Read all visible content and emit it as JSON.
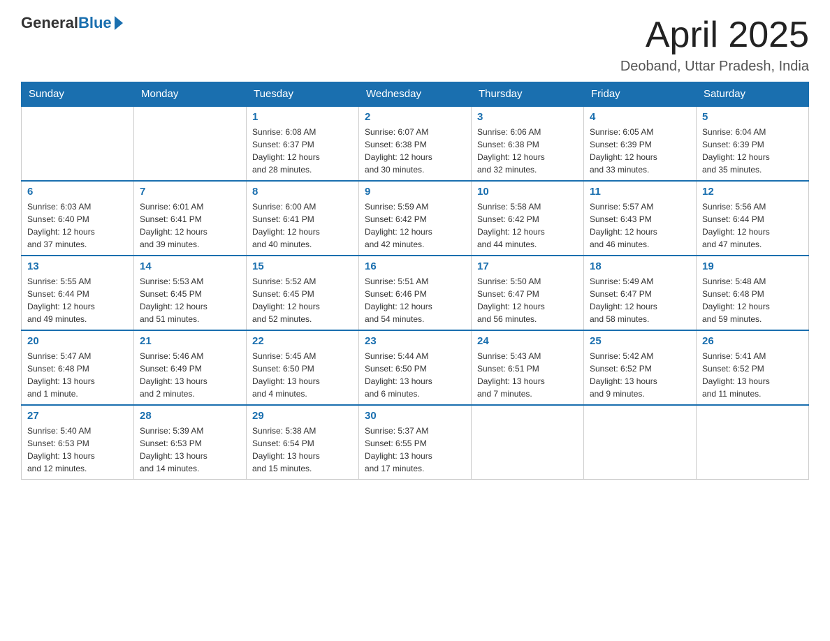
{
  "header": {
    "logo_general": "General",
    "logo_blue": "Blue",
    "month_title": "April 2025",
    "location": "Deoband, Uttar Pradesh, India"
  },
  "weekdays": [
    "Sunday",
    "Monday",
    "Tuesday",
    "Wednesday",
    "Thursday",
    "Friday",
    "Saturday"
  ],
  "weeks": [
    [
      {
        "day": "",
        "info": ""
      },
      {
        "day": "",
        "info": ""
      },
      {
        "day": "1",
        "info": "Sunrise: 6:08 AM\nSunset: 6:37 PM\nDaylight: 12 hours\nand 28 minutes."
      },
      {
        "day": "2",
        "info": "Sunrise: 6:07 AM\nSunset: 6:38 PM\nDaylight: 12 hours\nand 30 minutes."
      },
      {
        "day": "3",
        "info": "Sunrise: 6:06 AM\nSunset: 6:38 PM\nDaylight: 12 hours\nand 32 minutes."
      },
      {
        "day": "4",
        "info": "Sunrise: 6:05 AM\nSunset: 6:39 PM\nDaylight: 12 hours\nand 33 minutes."
      },
      {
        "day": "5",
        "info": "Sunrise: 6:04 AM\nSunset: 6:39 PM\nDaylight: 12 hours\nand 35 minutes."
      }
    ],
    [
      {
        "day": "6",
        "info": "Sunrise: 6:03 AM\nSunset: 6:40 PM\nDaylight: 12 hours\nand 37 minutes."
      },
      {
        "day": "7",
        "info": "Sunrise: 6:01 AM\nSunset: 6:41 PM\nDaylight: 12 hours\nand 39 minutes."
      },
      {
        "day": "8",
        "info": "Sunrise: 6:00 AM\nSunset: 6:41 PM\nDaylight: 12 hours\nand 40 minutes."
      },
      {
        "day": "9",
        "info": "Sunrise: 5:59 AM\nSunset: 6:42 PM\nDaylight: 12 hours\nand 42 minutes."
      },
      {
        "day": "10",
        "info": "Sunrise: 5:58 AM\nSunset: 6:42 PM\nDaylight: 12 hours\nand 44 minutes."
      },
      {
        "day": "11",
        "info": "Sunrise: 5:57 AM\nSunset: 6:43 PM\nDaylight: 12 hours\nand 46 minutes."
      },
      {
        "day": "12",
        "info": "Sunrise: 5:56 AM\nSunset: 6:44 PM\nDaylight: 12 hours\nand 47 minutes."
      }
    ],
    [
      {
        "day": "13",
        "info": "Sunrise: 5:55 AM\nSunset: 6:44 PM\nDaylight: 12 hours\nand 49 minutes."
      },
      {
        "day": "14",
        "info": "Sunrise: 5:53 AM\nSunset: 6:45 PM\nDaylight: 12 hours\nand 51 minutes."
      },
      {
        "day": "15",
        "info": "Sunrise: 5:52 AM\nSunset: 6:45 PM\nDaylight: 12 hours\nand 52 minutes."
      },
      {
        "day": "16",
        "info": "Sunrise: 5:51 AM\nSunset: 6:46 PM\nDaylight: 12 hours\nand 54 minutes."
      },
      {
        "day": "17",
        "info": "Sunrise: 5:50 AM\nSunset: 6:47 PM\nDaylight: 12 hours\nand 56 minutes."
      },
      {
        "day": "18",
        "info": "Sunrise: 5:49 AM\nSunset: 6:47 PM\nDaylight: 12 hours\nand 58 minutes."
      },
      {
        "day": "19",
        "info": "Sunrise: 5:48 AM\nSunset: 6:48 PM\nDaylight: 12 hours\nand 59 minutes."
      }
    ],
    [
      {
        "day": "20",
        "info": "Sunrise: 5:47 AM\nSunset: 6:48 PM\nDaylight: 13 hours\nand 1 minute."
      },
      {
        "day": "21",
        "info": "Sunrise: 5:46 AM\nSunset: 6:49 PM\nDaylight: 13 hours\nand 2 minutes."
      },
      {
        "day": "22",
        "info": "Sunrise: 5:45 AM\nSunset: 6:50 PM\nDaylight: 13 hours\nand 4 minutes."
      },
      {
        "day": "23",
        "info": "Sunrise: 5:44 AM\nSunset: 6:50 PM\nDaylight: 13 hours\nand 6 minutes."
      },
      {
        "day": "24",
        "info": "Sunrise: 5:43 AM\nSunset: 6:51 PM\nDaylight: 13 hours\nand 7 minutes."
      },
      {
        "day": "25",
        "info": "Sunrise: 5:42 AM\nSunset: 6:52 PM\nDaylight: 13 hours\nand 9 minutes."
      },
      {
        "day": "26",
        "info": "Sunrise: 5:41 AM\nSunset: 6:52 PM\nDaylight: 13 hours\nand 11 minutes."
      }
    ],
    [
      {
        "day": "27",
        "info": "Sunrise: 5:40 AM\nSunset: 6:53 PM\nDaylight: 13 hours\nand 12 minutes."
      },
      {
        "day": "28",
        "info": "Sunrise: 5:39 AM\nSunset: 6:53 PM\nDaylight: 13 hours\nand 14 minutes."
      },
      {
        "day": "29",
        "info": "Sunrise: 5:38 AM\nSunset: 6:54 PM\nDaylight: 13 hours\nand 15 minutes."
      },
      {
        "day": "30",
        "info": "Sunrise: 5:37 AM\nSunset: 6:55 PM\nDaylight: 13 hours\nand 17 minutes."
      },
      {
        "day": "",
        "info": ""
      },
      {
        "day": "",
        "info": ""
      },
      {
        "day": "",
        "info": ""
      }
    ]
  ]
}
